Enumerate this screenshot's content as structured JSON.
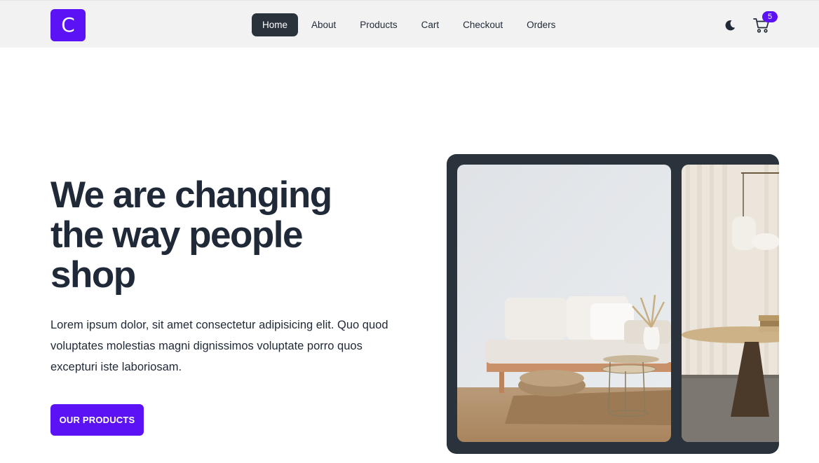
{
  "nav": {
    "logo": "C",
    "links": [
      {
        "label": "Home",
        "active": true
      },
      {
        "label": "About",
        "active": false
      },
      {
        "label": "Products",
        "active": false
      },
      {
        "label": "Cart",
        "active": false
      },
      {
        "label": "Checkout",
        "active": false
      },
      {
        "label": "Orders",
        "active": false
      }
    ],
    "theme_icon": "moon-icon",
    "cart_icon": "cart-icon",
    "cart_count": "5"
  },
  "hero": {
    "title": "We are changing the way people shop",
    "description": "Lorem ipsum dolor, sit amet consectetur adipisicing elit. Quo quod voluptates molestias magni dignissimos voluptate porro quos excepturi iste laboriosam.",
    "cta_label": "OUR PRODUCTS"
  },
  "carousel": {
    "slides": [
      "living room with sofa and side tables",
      "room with round wooden table and curtains"
    ]
  },
  "colors": {
    "accent": "#5b12f5",
    "dark": "#2a323c",
    "navbar_bg": "#f2f2f2",
    "text": "#1f2937"
  }
}
